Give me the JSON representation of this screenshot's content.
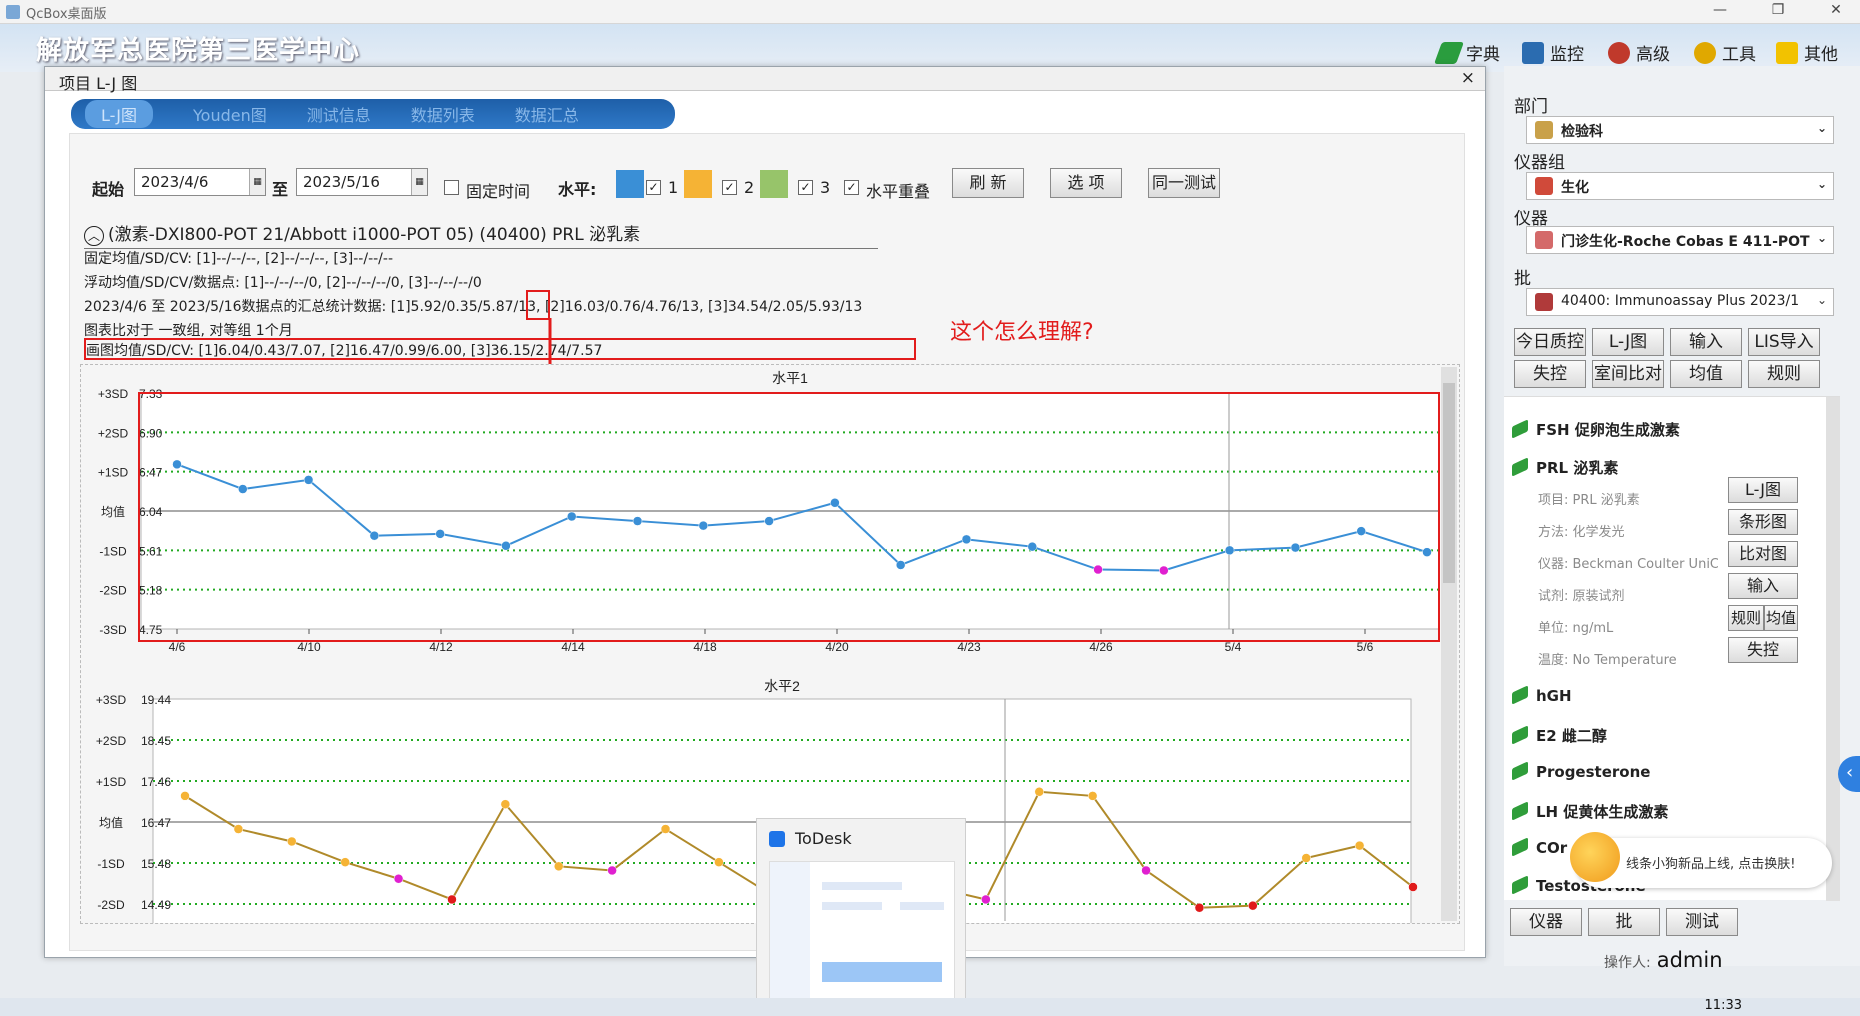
{
  "window": {
    "title": "QcBox桌面版"
  },
  "header": {
    "hospital": "解放军总医院第三医学中心",
    "menu": [
      {
        "label": "字典",
        "icon": "dictionary-icon",
        "color": "#2a9d3e"
      },
      {
        "label": "监控",
        "icon": "monitor-icon",
        "color": "#2b6cb0"
      },
      {
        "label": "高级",
        "icon": "advanced-icon",
        "color": "#c0392b"
      },
      {
        "label": "工具",
        "icon": "tools-icon",
        "color": "#e0a800"
      },
      {
        "label": "其他",
        "icon": "other-icon",
        "color": "#f2c200"
      }
    ]
  },
  "dialog": {
    "title": "项目 L-J 图",
    "close": "×",
    "tabs": [
      "L-J图",
      "Youden图",
      "测试信息",
      "数据列表",
      "数据汇总"
    ]
  },
  "controls": {
    "start_label": "起始",
    "start_date": "2023/4/6",
    "to_label": "至",
    "end_date": "2023/5/16",
    "fixed_time_label": "固定时间",
    "level_label": "水平:",
    "level_colors": [
      "#3a8fd6",
      "#f5b335",
      "#97c46a"
    ],
    "level_names": [
      "1",
      "2",
      "3"
    ],
    "overlap_label": "水平重叠",
    "refresh": "刷 新",
    "options": "选 项",
    "same_test": "同一测试"
  },
  "info": {
    "title": "(激素-DXI800-POT 21/Abbott i1000-POT 05)  (40400)  PRL 泌乳素",
    "line1": "固定均值/SD/CV:  [1]--/--/--,  [2]--/--/--,  [3]--/--/--",
    "line2": "浮动均值/SD/CV/数据点:  [1]--/--/--/0,  [2]--/--/--/0,  [3]--/--/--/0",
    "line3": "2023/4/6 至 2023/5/16数据点的汇总统计数据:  [1]5.92/0.35/5.87/13,  [2]16.03/0.76/4.76/13,  [3]34.54/2.05/5.93/13",
    "line4": "图表比对于 一致组, 对等组 1个月",
    "line5": "画图均值/SD/CV:  [1]6.04/0.43/7.07,  [2]16.47/0.99/6.00,  [3]36.15/2.74/7.57",
    "annotation": "这个怎么理解?"
  },
  "chart_data": [
    {
      "type": "line",
      "title": "水平1",
      "sd_labels": [
        "+3SD",
        "+2SD",
        "+1SD",
        "均值",
        "-1SD",
        "-2SD",
        "-3SD"
      ],
      "y_ticks": [
        "7.33",
        "6.90",
        "6.47",
        "6.04",
        "5.61",
        "5.18",
        "4.75"
      ],
      "ylim": [
        4.75,
        7.33
      ],
      "x_ticks": [
        "4/6",
        "4/10",
        "4/12",
        "4/14",
        "4/18",
        "4/20",
        "4/23",
        "4/26",
        "5/4",
        "5/6"
      ],
      "series": [
        {
          "color": "#3a8fd6",
          "values": [
            6.55,
            6.28,
            6.38,
            5.77,
            5.79,
            5.66,
            5.98,
            5.93,
            5.88,
            5.93,
            6.13,
            5.45,
            5.73,
            5.65,
            5.4,
            5.39,
            5.61,
            5.64,
            5.82,
            5.59
          ],
          "marker_colors": [
            "#3a8fd6",
            "#3a8fd6",
            "#3a8fd6",
            "#3a8fd6",
            "#3a8fd6",
            "#3a8fd6",
            "#3a8fd6",
            "#3a8fd6",
            "#3a8fd6",
            "#3a8fd6",
            "#3a8fd6",
            "#3a8fd6",
            "#3a8fd6",
            "#3a8fd6",
            "#e020d0",
            "#e020d0",
            "#3a8fd6",
            "#3a8fd6",
            "#3a8fd6",
            "#3a8fd6"
          ]
        }
      ]
    },
    {
      "type": "line",
      "title": "水平2",
      "sd_labels": [
        "+3SD",
        "+2SD",
        "+1SD",
        "均值",
        "-1SD",
        "-2SD"
      ],
      "y_ticks": [
        "19.44",
        "18.45",
        "17.46",
        "16.47",
        "15.48",
        "14.49"
      ],
      "ylim": [
        13.8,
        19.44
      ],
      "series": [
        {
          "color": "#b08a2a",
          "values": [
            17.1,
            16.3,
            16.0,
            15.5,
            15.1,
            14.6,
            16.9,
            15.4,
            15.3,
            16.3,
            15.5,
            14.7,
            14.3,
            14.5,
            14.9,
            14.6,
            17.2,
            17.1,
            15.3,
            14.4,
            14.45,
            15.6,
            15.9,
            14.9
          ],
          "marker_colors": [
            "#f5b335",
            "#f5b335",
            "#f5b335",
            "#f5b335",
            "#e020d0",
            "#e01a1a",
            "#f5b335",
            "#f5b335",
            "#e020d0",
            "#f5b335",
            "#f5b335",
            "#f5b335",
            "#e020d0",
            "#f5b335",
            "#f5b335",
            "#e020d0",
            "#f5b335",
            "#f5b335",
            "#e020d0",
            "#e01a1a",
            "#e01a1a",
            "#f5b335",
            "#f5b335",
            "#e01a1a"
          ]
        }
      ]
    }
  ],
  "rpanel": {
    "dept_label": "部门",
    "dept_value": "检验科",
    "group_label": "仪器组",
    "group_value": "生化",
    "instrument_label": "仪器",
    "instrument_value": "门诊生化-Roche Cobas E 411-POT",
    "lot_label": "批",
    "lot_value": "40400:  Immunoassay Plus 2023/1",
    "buttons_row1": [
      "今日质控",
      "L-J图",
      "输入",
      "LIS导入"
    ],
    "buttons_row2": [
      "失控",
      "室间比对",
      "均值",
      "规则"
    ],
    "items": [
      {
        "label": "FSH 促卵泡生成激素"
      },
      {
        "label": "PRL 泌乳素"
      },
      {
        "label": "hGH"
      },
      {
        "label": "E2 雌二醇"
      },
      {
        "label": "Progesterone"
      },
      {
        "label": "LH 促黄体生成激素"
      },
      {
        "label": "COr"
      },
      {
        "label": "Testosterone"
      }
    ],
    "details": [
      "项目: PRL 泌乳素",
      "方法: 化学发光",
      "仪器: Beckman Coulter UniCel",
      "试剂: 原装试剂",
      "单位: ng/mL",
      "温度: No Temperature"
    ],
    "detail_buttons": [
      "L-J图",
      "条形图",
      "比对图",
      "输入",
      "规则",
      "均值",
      "失控"
    ],
    "bottom_buttons": [
      "仪器",
      "批",
      "测试"
    ],
    "operator_label": "操作人:",
    "operator_name": "admin"
  },
  "todesk": {
    "title": "ToDesk"
  },
  "notify": {
    "text": "线条小狗新品上线, 点击换肤!"
  },
  "taskbar": {
    "clock": "11:33"
  }
}
